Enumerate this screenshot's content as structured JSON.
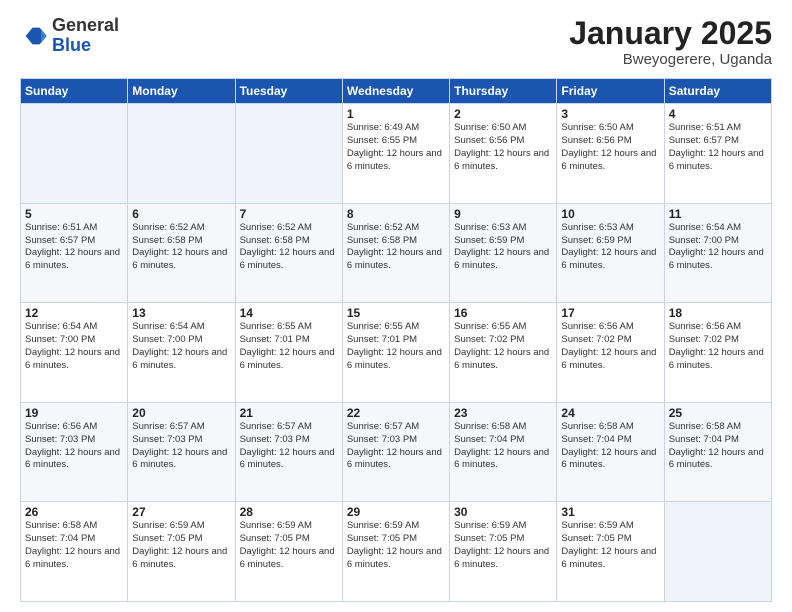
{
  "header": {
    "logo_general": "General",
    "logo_blue": "Blue",
    "month_title": "January 2025",
    "location": "Bweyogerere, Uganda"
  },
  "weekdays": [
    "Sunday",
    "Monday",
    "Tuesday",
    "Wednesday",
    "Thursday",
    "Friday",
    "Saturday"
  ],
  "weeks": [
    [
      {
        "day": "",
        "info": ""
      },
      {
        "day": "",
        "info": ""
      },
      {
        "day": "",
        "info": ""
      },
      {
        "day": "1",
        "info": "Sunrise: 6:49 AM\nSunset: 6:55 PM\nDaylight: 12 hours and 6 minutes."
      },
      {
        "day": "2",
        "info": "Sunrise: 6:50 AM\nSunset: 6:56 PM\nDaylight: 12 hours and 6 minutes."
      },
      {
        "day": "3",
        "info": "Sunrise: 6:50 AM\nSunset: 6:56 PM\nDaylight: 12 hours and 6 minutes."
      },
      {
        "day": "4",
        "info": "Sunrise: 6:51 AM\nSunset: 6:57 PM\nDaylight: 12 hours and 6 minutes."
      }
    ],
    [
      {
        "day": "5",
        "info": "Sunrise: 6:51 AM\nSunset: 6:57 PM\nDaylight: 12 hours and 6 minutes."
      },
      {
        "day": "6",
        "info": "Sunrise: 6:52 AM\nSunset: 6:58 PM\nDaylight: 12 hours and 6 minutes."
      },
      {
        "day": "7",
        "info": "Sunrise: 6:52 AM\nSunset: 6:58 PM\nDaylight: 12 hours and 6 minutes."
      },
      {
        "day": "8",
        "info": "Sunrise: 6:52 AM\nSunset: 6:58 PM\nDaylight: 12 hours and 6 minutes."
      },
      {
        "day": "9",
        "info": "Sunrise: 6:53 AM\nSunset: 6:59 PM\nDaylight: 12 hours and 6 minutes."
      },
      {
        "day": "10",
        "info": "Sunrise: 6:53 AM\nSunset: 6:59 PM\nDaylight: 12 hours and 6 minutes."
      },
      {
        "day": "11",
        "info": "Sunrise: 6:54 AM\nSunset: 7:00 PM\nDaylight: 12 hours and 6 minutes."
      }
    ],
    [
      {
        "day": "12",
        "info": "Sunrise: 6:54 AM\nSunset: 7:00 PM\nDaylight: 12 hours and 6 minutes."
      },
      {
        "day": "13",
        "info": "Sunrise: 6:54 AM\nSunset: 7:00 PM\nDaylight: 12 hours and 6 minutes."
      },
      {
        "day": "14",
        "info": "Sunrise: 6:55 AM\nSunset: 7:01 PM\nDaylight: 12 hours and 6 minutes."
      },
      {
        "day": "15",
        "info": "Sunrise: 6:55 AM\nSunset: 7:01 PM\nDaylight: 12 hours and 6 minutes."
      },
      {
        "day": "16",
        "info": "Sunrise: 6:55 AM\nSunset: 7:02 PM\nDaylight: 12 hours and 6 minutes."
      },
      {
        "day": "17",
        "info": "Sunrise: 6:56 AM\nSunset: 7:02 PM\nDaylight: 12 hours and 6 minutes."
      },
      {
        "day": "18",
        "info": "Sunrise: 6:56 AM\nSunset: 7:02 PM\nDaylight: 12 hours and 6 minutes."
      }
    ],
    [
      {
        "day": "19",
        "info": "Sunrise: 6:56 AM\nSunset: 7:03 PM\nDaylight: 12 hours and 6 minutes."
      },
      {
        "day": "20",
        "info": "Sunrise: 6:57 AM\nSunset: 7:03 PM\nDaylight: 12 hours and 6 minutes."
      },
      {
        "day": "21",
        "info": "Sunrise: 6:57 AM\nSunset: 7:03 PM\nDaylight: 12 hours and 6 minutes."
      },
      {
        "day": "22",
        "info": "Sunrise: 6:57 AM\nSunset: 7:03 PM\nDaylight: 12 hours and 6 minutes."
      },
      {
        "day": "23",
        "info": "Sunrise: 6:58 AM\nSunset: 7:04 PM\nDaylight: 12 hours and 6 minutes."
      },
      {
        "day": "24",
        "info": "Sunrise: 6:58 AM\nSunset: 7:04 PM\nDaylight: 12 hours and 6 minutes."
      },
      {
        "day": "25",
        "info": "Sunrise: 6:58 AM\nSunset: 7:04 PM\nDaylight: 12 hours and 6 minutes."
      }
    ],
    [
      {
        "day": "26",
        "info": "Sunrise: 6:58 AM\nSunset: 7:04 PM\nDaylight: 12 hours and 6 minutes."
      },
      {
        "day": "27",
        "info": "Sunrise: 6:59 AM\nSunset: 7:05 PM\nDaylight: 12 hours and 6 minutes."
      },
      {
        "day": "28",
        "info": "Sunrise: 6:59 AM\nSunset: 7:05 PM\nDaylight: 12 hours and 6 minutes."
      },
      {
        "day": "29",
        "info": "Sunrise: 6:59 AM\nSunset: 7:05 PM\nDaylight: 12 hours and 6 minutes."
      },
      {
        "day": "30",
        "info": "Sunrise: 6:59 AM\nSunset: 7:05 PM\nDaylight: 12 hours and 6 minutes."
      },
      {
        "day": "31",
        "info": "Sunrise: 6:59 AM\nSunset: 7:05 PM\nDaylight: 12 hours and 6 minutes."
      },
      {
        "day": "",
        "info": ""
      }
    ]
  ]
}
